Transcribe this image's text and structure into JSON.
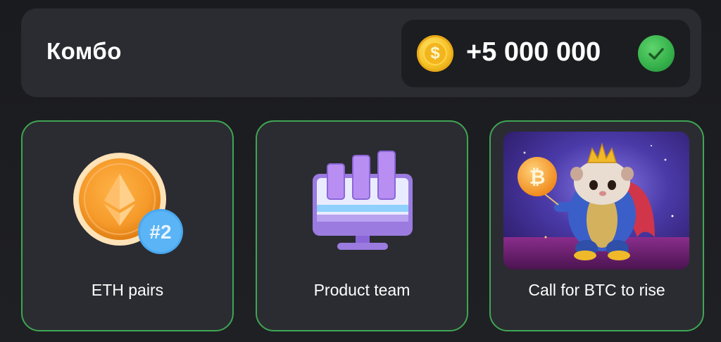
{
  "combo": {
    "title": "Комбо",
    "reward": {
      "coin_icon": "dollar-coin-icon",
      "amount": "+5 000 000",
      "status_icon": "check-circle-icon",
      "status_color": "#34b04a"
    }
  },
  "cards": [
    {
      "label": "ETH pairs",
      "icon": "ethereum-coin-icon",
      "badge": "#2"
    },
    {
      "label": "Product team",
      "icon": "monitor-chart-icon"
    },
    {
      "label": "Call for BTC to rise",
      "image": "hamster-king-bitcoin-image"
    }
  ],
  "colors": {
    "card_border": "#3fa553",
    "panel_bg": "#2b2c31",
    "page_bg": "#1c1d21"
  }
}
